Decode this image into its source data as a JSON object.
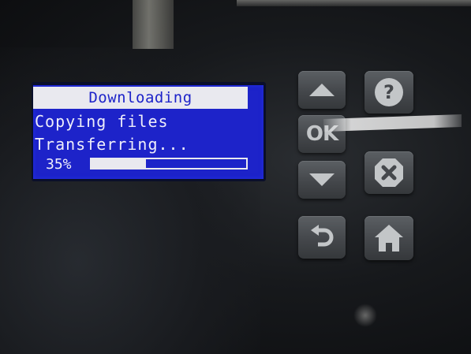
{
  "lcd": {
    "title": "Downloading",
    "line1": "Copying files",
    "line2": "Transferring...",
    "progress_text": "35%",
    "progress_value": 0.35
  },
  "keypad": {
    "ok_label": "OK",
    "icons": [
      "up-arrow-icon",
      "ok-icon",
      "down-arrow-icon",
      "back-arrow-icon",
      "help-icon",
      "cancel-icon",
      "home-icon"
    ]
  },
  "colors": {
    "lcd_background": "#1d23c9",
    "lcd_text": "#eeeefa",
    "key_face": "#4a4d51"
  }
}
